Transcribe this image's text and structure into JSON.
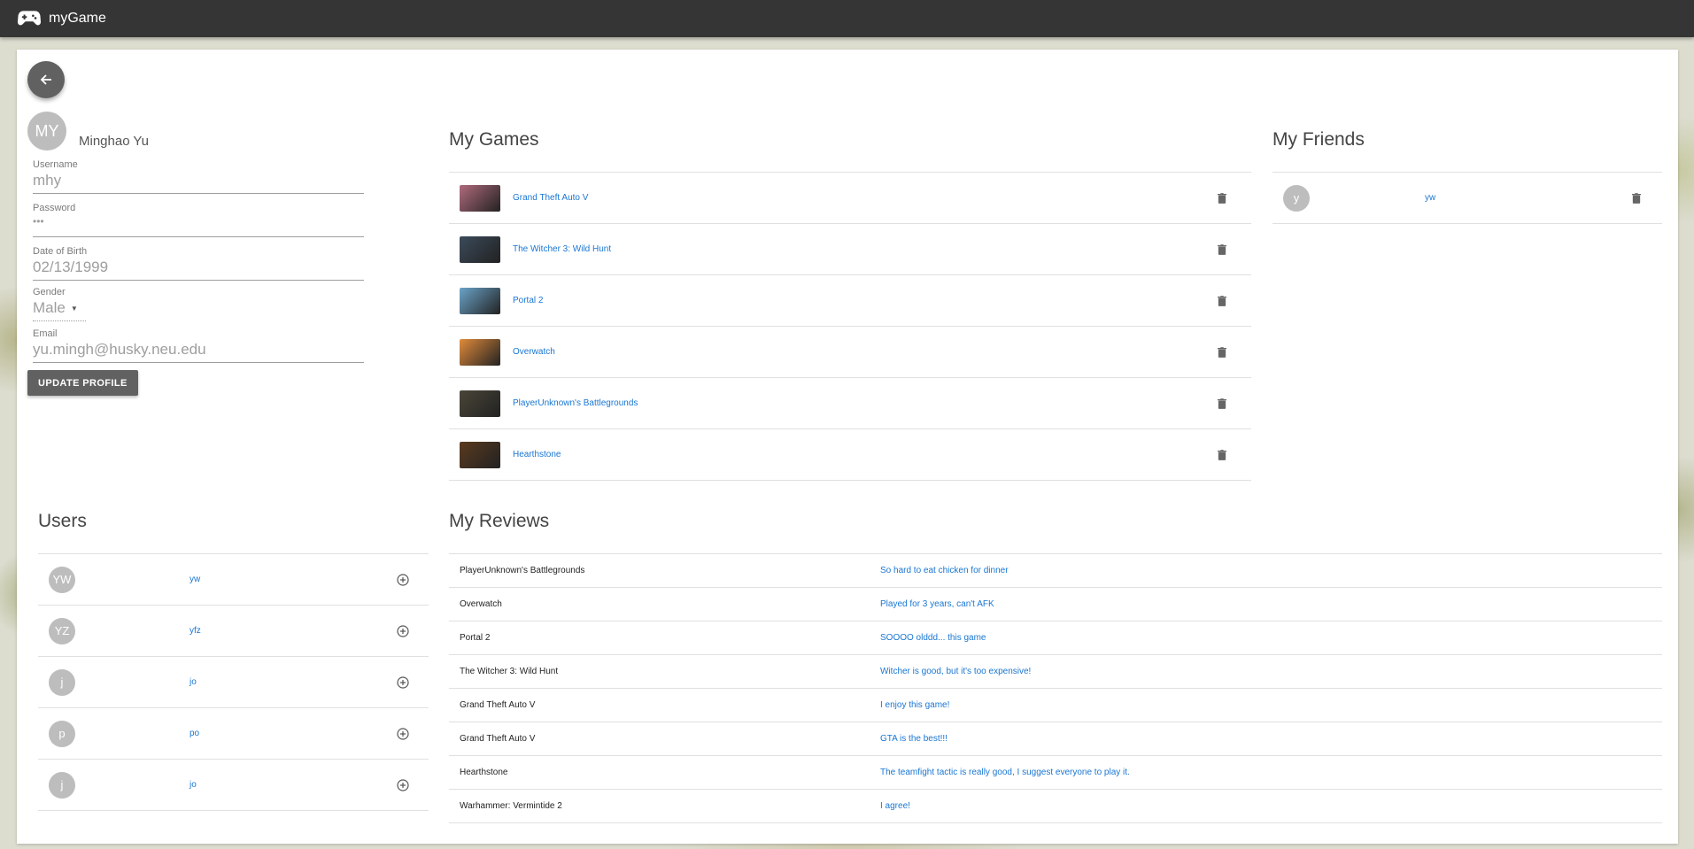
{
  "app": {
    "title": "myGame"
  },
  "profile": {
    "initials": "MY",
    "name": "Minghao Yu",
    "fields": {
      "username": {
        "label": "Username",
        "value": "mhy"
      },
      "password": {
        "label": "Password",
        "value": "•••"
      },
      "dob": {
        "label": "Date of Birth",
        "value": "02/13/1999"
      },
      "gender": {
        "label": "Gender",
        "value": "Male"
      },
      "email": {
        "label": "Email",
        "value": "yu.mingh@husky.neu.edu"
      }
    },
    "update_label": "UPDATE PROFILE"
  },
  "games": {
    "title": "My Games",
    "items": [
      {
        "name": "Grand Theft Auto V",
        "thumb": "#b06a7c"
      },
      {
        "name": "The Witcher 3: Wild Hunt",
        "thumb": "#3b4a5a"
      },
      {
        "name": "Portal 2",
        "thumb": "#6aa3c8"
      },
      {
        "name": "Overwatch",
        "thumb": "#e08a3a"
      },
      {
        "name": "PlayerUnknown's Battlegrounds",
        "thumb": "#4a4538"
      },
      {
        "name": "Hearthstone",
        "thumb": "#5a3a1e"
      }
    ]
  },
  "friends": {
    "title": "My Friends",
    "items": [
      {
        "initial": "y",
        "name": "yw"
      }
    ]
  },
  "users": {
    "title": "Users",
    "items": [
      {
        "initial": "YW",
        "name": "yw"
      },
      {
        "initial": "YZ",
        "name": "yfz"
      },
      {
        "initial": "j",
        "name": "jo"
      },
      {
        "initial": "p",
        "name": "po"
      },
      {
        "initial": "j",
        "name": "jo"
      }
    ]
  },
  "reviews": {
    "title": "My Reviews",
    "items": [
      {
        "game": "PlayerUnknown's Battlegrounds",
        "text": "So hard to eat chicken for dinner"
      },
      {
        "game": "Overwatch",
        "text": "Played for 3 years, can't AFK"
      },
      {
        "game": "Portal 2",
        "text": "SOOOO olddd... this game"
      },
      {
        "game": "The Witcher 3: Wild Hunt",
        "text": "Witcher is good, but it's too expensive!"
      },
      {
        "game": "Grand Theft Auto V",
        "text": "I enjoy this game!"
      },
      {
        "game": "Grand Theft Auto V",
        "text": "GTA is the best!!!"
      },
      {
        "game": "Hearthstone",
        "text": "The teamfight tactic is really good, I suggest everyone to play it."
      },
      {
        "game": "Warhammer: Vermintide 2",
        "text": "I agree!"
      }
    ]
  }
}
